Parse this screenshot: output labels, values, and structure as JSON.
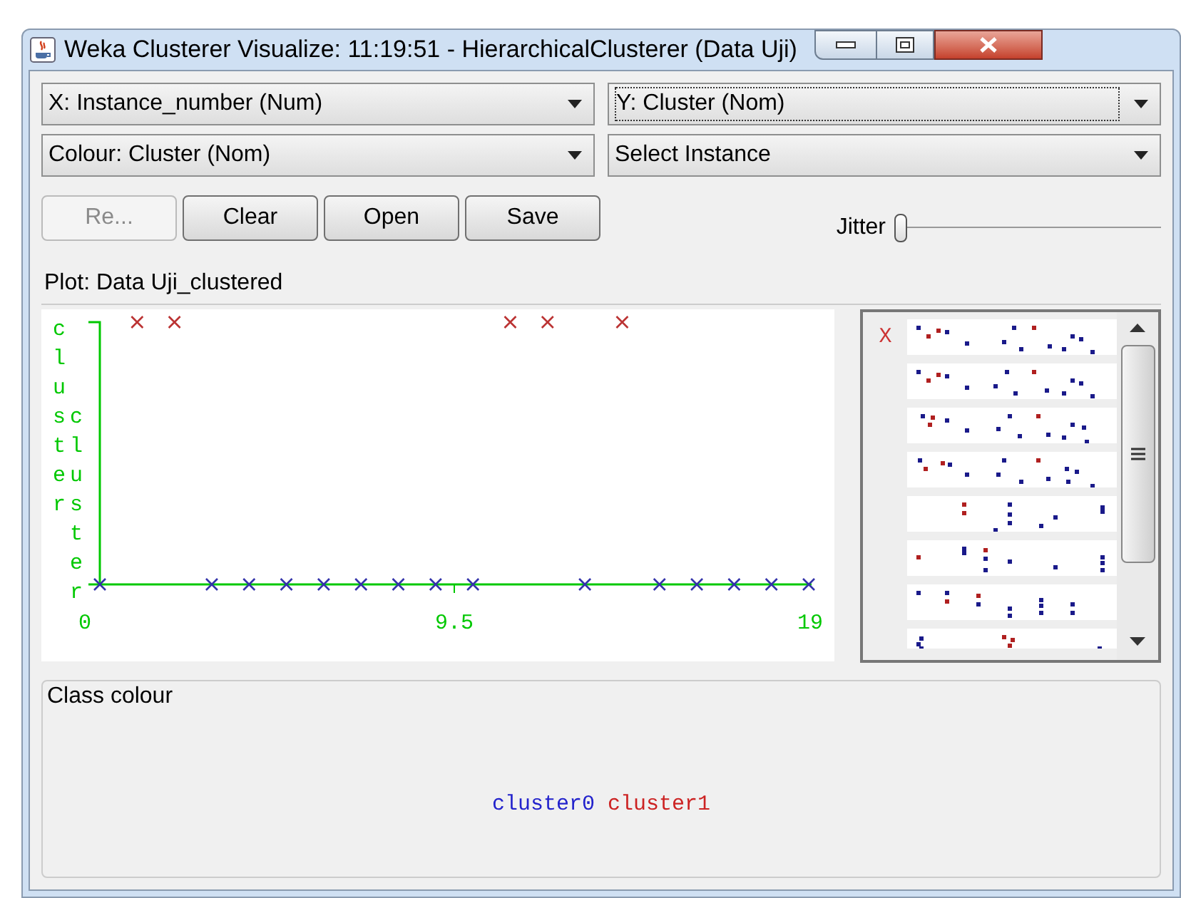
{
  "window": {
    "title": "Weka Clusterer Visualize: 11:19:51 - HierarchicalClusterer (Data Uji)"
  },
  "selectors": [
    {
      "label": "X: Instance_number (Num)",
      "focused": false
    },
    {
      "label": "Y: Cluster (Nom)",
      "focused": true
    },
    {
      "label": "Colour: Cluster (Nom)",
      "focused": false
    },
    {
      "label": "Select Instance",
      "focused": false
    }
  ],
  "buttons": [
    {
      "label": "Re...",
      "disabled": true
    },
    {
      "label": "Clear",
      "disabled": false
    },
    {
      "label": "Open",
      "disabled": false
    },
    {
      "label": "Save",
      "disabled": false
    }
  ],
  "jitter": {
    "label": "Jitter",
    "level": 0
  },
  "plot": {
    "title": "Plot: Data Uji_clustered",
    "y_axis_labels": [
      "cluster",
      "cluster"
    ],
    "x_tick_labels": [
      "0",
      "9.5",
      "19"
    ]
  },
  "attribute_panel": {
    "marker": "X"
  },
  "class_colour": {
    "title": "Class colour",
    "classes": [
      {
        "name": "cluster0",
        "color": "#2222cc"
      },
      {
        "name": "cluster1",
        "color": "#cc2222"
      }
    ]
  }
}
